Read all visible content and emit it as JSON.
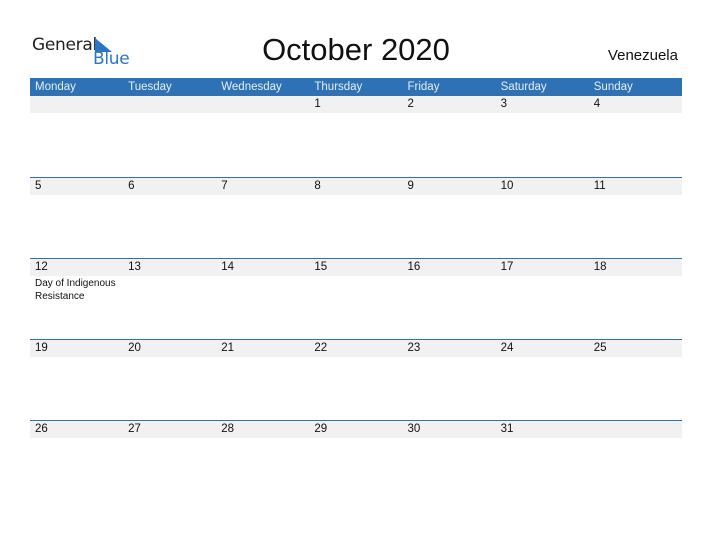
{
  "logo": {
    "word1": "General",
    "word2": "Blue"
  },
  "title": "October 2020",
  "country": "Venezuela",
  "weekdays": [
    "Monday",
    "Tuesday",
    "Wednesday",
    "Thursday",
    "Friday",
    "Saturday",
    "Sunday"
  ],
  "weeks": [
    {
      "days": [
        "",
        "",
        "",
        "1",
        "2",
        "3",
        "4"
      ],
      "events": [
        "",
        "",
        "",
        "",
        "",
        "",
        ""
      ]
    },
    {
      "days": [
        "5",
        "6",
        "7",
        "8",
        "9",
        "10",
        "11"
      ],
      "events": [
        "",
        "",
        "",
        "",
        "",
        "",
        ""
      ]
    },
    {
      "days": [
        "12",
        "13",
        "14",
        "15",
        "16",
        "17",
        "18"
      ],
      "events": [
        "Day of Indigenous Resistance",
        "",
        "",
        "",
        "",
        "",
        ""
      ]
    },
    {
      "days": [
        "19",
        "20",
        "21",
        "22",
        "23",
        "24",
        "25"
      ],
      "events": [
        "",
        "",
        "",
        "",
        "",
        "",
        ""
      ]
    },
    {
      "days": [
        "26",
        "27",
        "28",
        "29",
        "30",
        "31",
        ""
      ],
      "events": [
        "",
        "",
        "",
        "",
        "",
        "",
        ""
      ]
    }
  ],
  "colors": {
    "accent": "#2e72b5",
    "band": "#f1f1f1",
    "logo_blue": "#2a76c6"
  }
}
